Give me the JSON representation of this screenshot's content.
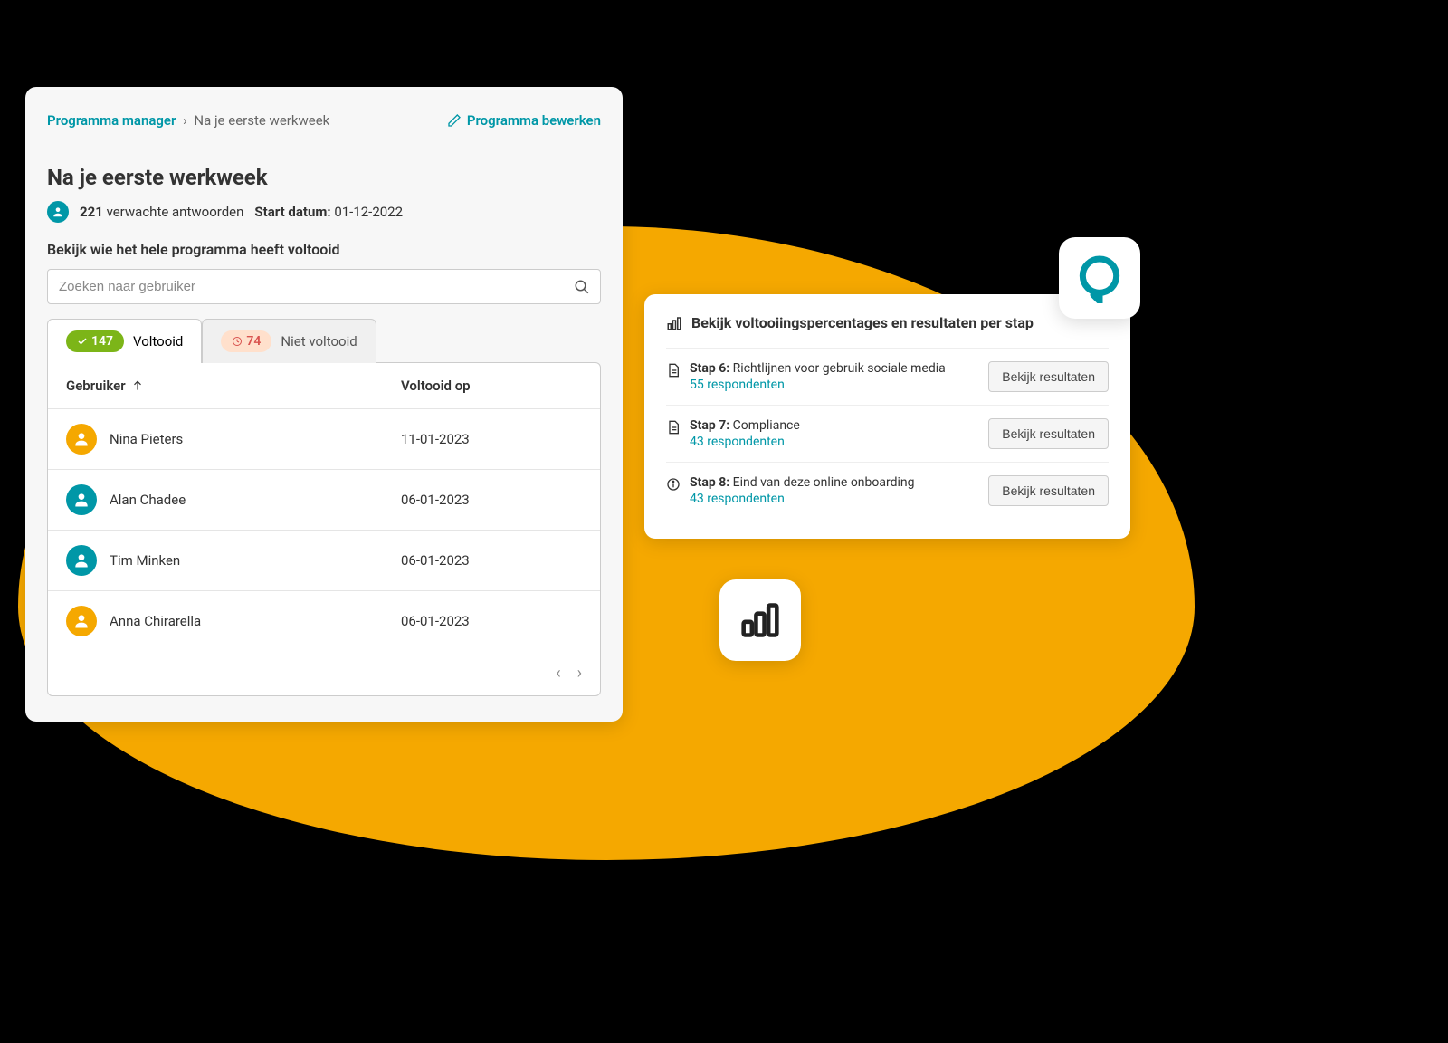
{
  "breadcrumb": {
    "root": "Programma manager",
    "current": "Na je eerste werkweek"
  },
  "edit_label": "Programma bewerken",
  "title": "Na je eerste werkweek",
  "meta": {
    "count": "221",
    "count_label": "verwachte antwoorden",
    "start_label": "Start datum:",
    "start_date": "01-12-2022"
  },
  "subtitle": "Bekijk wie het hele programma heeft voltooid",
  "search": {
    "placeholder": "Zoeken naar gebruiker"
  },
  "tabs": {
    "completed": {
      "count": "147",
      "label": "Voltooid"
    },
    "not_completed": {
      "count": "74",
      "label": "Niet voltooid"
    }
  },
  "table": {
    "col_user": "Gebruiker",
    "col_date": "Voltooid op",
    "rows": [
      {
        "name": "Nina Pieters",
        "date": "11-01-2023",
        "bg": "#f5a800"
      },
      {
        "name": "Alan Chadee",
        "date": "06-01-2023",
        "bg": "#0097a7"
      },
      {
        "name": "Tim Minken",
        "date": "06-01-2023",
        "bg": "#0097a7"
      },
      {
        "name": "Anna Chirarella",
        "date": "06-01-2023",
        "bg": "#f5a800"
      }
    ]
  },
  "side": {
    "header": "Bekijk voltooiingspercentages en resultaten per stap",
    "result_label": "Bekijk resultaten",
    "steps": [
      {
        "icon": "doc",
        "step_label": "Stap 6:",
        "title": "Richtlijnen voor gebruik sociale media",
        "respondents": "55 respondenten"
      },
      {
        "icon": "doc",
        "step_label": "Stap 7:",
        "title": "Compliance",
        "respondents": "43 respondenten"
      },
      {
        "icon": "info",
        "step_label": "Stap 8:",
        "title": "Eind van deze online onboarding",
        "respondents": "43 respondenten"
      }
    ]
  }
}
